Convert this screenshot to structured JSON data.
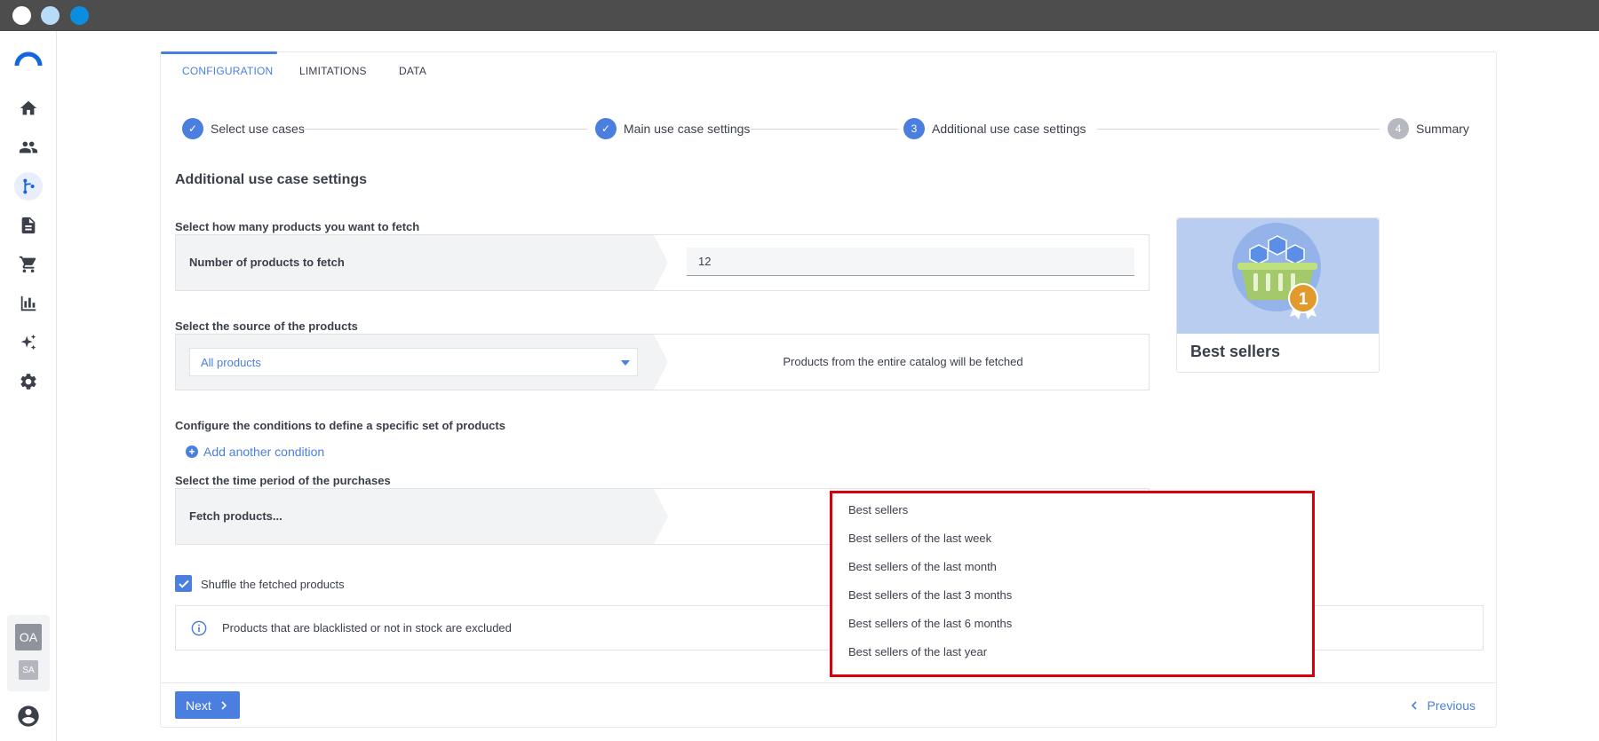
{
  "window": {
    "dots": [
      "#ffffff",
      "#b8dcf8",
      "#0b8de0"
    ]
  },
  "tabs": [
    {
      "label": "CONFIGURATION",
      "active": true
    },
    {
      "label": "LIMITATIONS",
      "active": false
    },
    {
      "label": "DATA",
      "active": false
    }
  ],
  "stepper": [
    {
      "marker": "✓",
      "label": "Select use cases",
      "state": "done"
    },
    {
      "marker": "✓",
      "label": "Main use case settings",
      "state": "done"
    },
    {
      "marker": "3",
      "label": "Additional use case settings",
      "state": "current"
    },
    {
      "marker": "4",
      "label": "Summary",
      "state": "pending"
    }
  ],
  "section_title": "Additional use case settings",
  "fetch_count": {
    "label": "Select how many products you want to fetch",
    "row_label": "Number of products to fetch",
    "value": "12"
  },
  "source": {
    "label": "Select the source of the products",
    "selected": "All products",
    "description": "Products from the entire catalog will be fetched"
  },
  "conditions": {
    "label": "Configure the conditions to define a specific set of products",
    "add_label": "Add another condition"
  },
  "time_period": {
    "label": "Select the time period of the purchases",
    "row_label": "Fetch products...",
    "options": [
      "Best sellers",
      "Best sellers of the last week",
      "Best sellers of the last month",
      "Best sellers of the last 3 months",
      "Best sellers of the last 6 months",
      "Best sellers of the last year"
    ]
  },
  "shuffle": {
    "label": "Shuffle the fetched products",
    "checked": true
  },
  "info": {
    "text": "Products that are blacklisted or not in stock are excluded"
  },
  "footer": {
    "next_label": "Next",
    "previous_label": "Previous"
  },
  "product_card": {
    "title": "Best sellers",
    "badge": "1"
  },
  "user": {
    "primary_initials": "OA",
    "secondary_initials": "SA"
  },
  "sidebar_icons": [
    "home-icon",
    "users-icon",
    "scenario-branch-icon",
    "document-icon",
    "cart-icon",
    "analytics-chart-icon",
    "ai-sparkle-icon",
    "settings-gear-icon"
  ],
  "colors": {
    "accent": "#4a7fdf",
    "highlight_border": "#d9000d",
    "badge": "#e39a2c"
  }
}
